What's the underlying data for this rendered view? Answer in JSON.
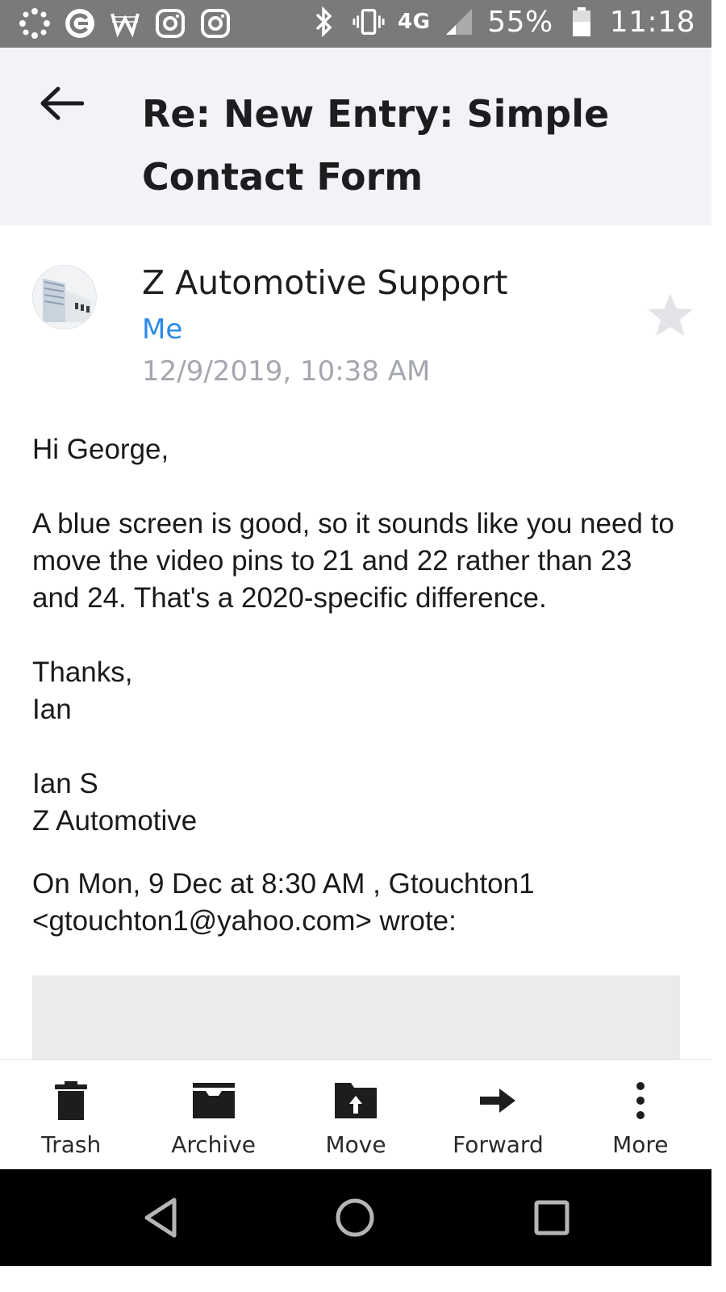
{
  "status_bar": {
    "battery_percent": "55%",
    "time": "11:18",
    "network": "4G",
    "left_icons": [
      "pinwheel-icon",
      "e-app-icon",
      "w-app-icon",
      "instagram-icon",
      "instagram-icon"
    ],
    "right_icons": [
      "bluetooth-icon",
      "vibrate-icon",
      "lte-icon",
      "signal-icon",
      "battery-icon"
    ]
  },
  "header": {
    "subject": "Re: New Entry: Simple Contact Form",
    "back_icon": "arrow-left-icon"
  },
  "message": {
    "sender": "Z Automotive Support",
    "recipient": "Me",
    "date": "12/9/2019, 10:38 AM",
    "body": {
      "greeting": "Hi George,",
      "paragraph": "A blue screen is good, so it sounds like you need to move the video pins to 21 and 22 rather than 23 and 24. That's a 2020-specific difference.",
      "signoff_1": "Thanks,",
      "signoff_2": "Ian",
      "signature_1": "Ian S",
      "signature_2": "Z Automotive",
      "quote_header_1": "On Mon, 9 Dec at 8:30 AM , Gtouchton1",
      "quote_header_2": "<gtouchton1@yahoo.com> wrote:"
    }
  },
  "toolbar": {
    "items": [
      {
        "label": "Trash",
        "icon": "trash-icon"
      },
      {
        "label": "Archive",
        "icon": "archive-icon"
      },
      {
        "label": "Move",
        "icon": "move-folder-icon"
      },
      {
        "label": "Forward",
        "icon": "forward-arrow-icon"
      },
      {
        "label": "More",
        "icon": "more-vertical-icon"
      }
    ]
  },
  "colors": {
    "status_bar": "#7a7a7a",
    "header_bg": "#f2f3f6",
    "link_blue": "#2b8be8",
    "date_gray": "#a4a7ad",
    "quote_bg": "#ebebeb"
  }
}
